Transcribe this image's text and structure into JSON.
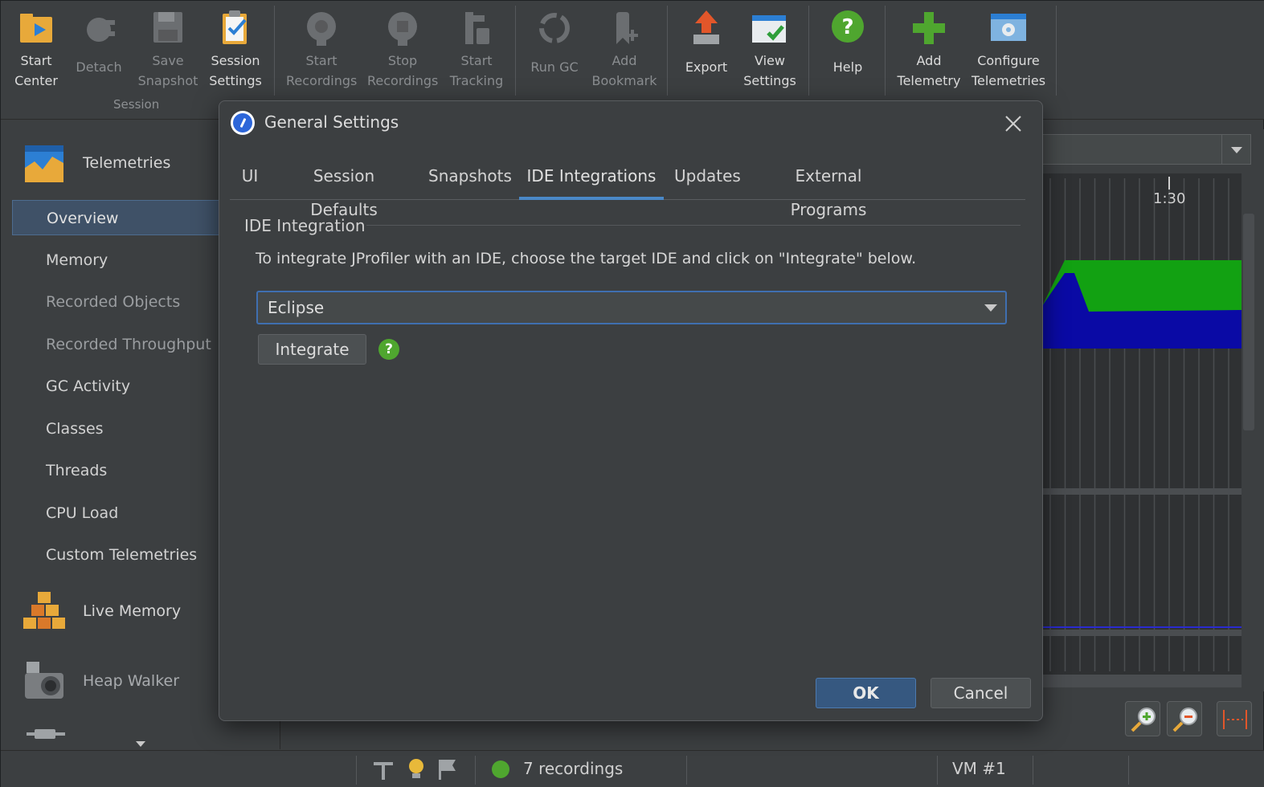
{
  "toolbar": {
    "buttons": [
      {
        "label": "Start\nCenter",
        "icon": "folder-play-icon",
        "enabled": true
      },
      {
        "label": "Detach",
        "icon": "plug-icon",
        "enabled": false
      },
      {
        "label": "Save\nSnapshot",
        "icon": "floppy-disk-icon",
        "enabled": false
      },
      {
        "label": "Session\nSettings",
        "icon": "clipboard-check-icon",
        "enabled": true
      },
      {
        "label": "Start\nRecordings",
        "icon": "record-icon",
        "enabled": false
      },
      {
        "label": "Stop\nRecordings",
        "icon": "stop-record-icon",
        "enabled": false
      },
      {
        "label": "Start\nTracking",
        "icon": "tracking-icon",
        "enabled": false
      },
      {
        "label": "Run GC",
        "icon": "recycle-icon",
        "enabled": false
      },
      {
        "label": "Add\nBookmark",
        "icon": "bookmark-icon",
        "enabled": false
      },
      {
        "label": "Export",
        "icon": "export-arrow-icon",
        "enabled": true
      },
      {
        "label": "View\nSettings",
        "icon": "window-check-icon",
        "enabled": true
      },
      {
        "label": "Help",
        "icon": "help-icon",
        "enabled": true
      },
      {
        "label": "Add\nTelemetry",
        "icon": "plus-icon",
        "enabled": true
      },
      {
        "label": "Configure\nTelemetries",
        "icon": "gear-window-icon",
        "enabled": true
      }
    ],
    "group_session": "Session"
  },
  "sidebar": {
    "telemetries_label": "Telemetries",
    "items": [
      {
        "label": "Overview",
        "selected": true,
        "enabled": true
      },
      {
        "label": "Memory",
        "selected": false,
        "enabled": true
      },
      {
        "label": "Recorded Objects",
        "selected": false,
        "enabled": false
      },
      {
        "label": "Recorded Throughput",
        "selected": false,
        "enabled": false
      },
      {
        "label": "GC Activity",
        "selected": false,
        "enabled": true
      },
      {
        "label": "Classes",
        "selected": false,
        "enabled": true
      },
      {
        "label": "Threads",
        "selected": false,
        "enabled": true
      },
      {
        "label": "CPU Load",
        "selected": false,
        "enabled": true
      },
      {
        "label": "Custom Telemetries",
        "selected": false,
        "enabled": true
      }
    ],
    "live_memory_label": "Live Memory",
    "heap_walker_label": "Heap Walker"
  },
  "chart": {
    "tick_label": "1:30",
    "colors": {
      "green": "#12a112",
      "blue": "#0a0aa5"
    }
  },
  "dialog": {
    "title": "General Settings",
    "tabs": [
      "UI",
      "Session Defaults",
      "Snapshots",
      "IDE Integrations",
      "Updates",
      "External Programs"
    ],
    "selected_tab": "IDE Integrations",
    "group_title": "IDE Integration",
    "description": "To integrate JProfiler with an IDE, choose the target IDE and click on \"Integrate\" below.",
    "ide_select_value": "Eclipse",
    "integrate_label": "Integrate",
    "help_glyph": "?",
    "ok_label": "OK",
    "cancel_label": "Cancel"
  },
  "status": {
    "recordings": "7 recordings",
    "vm": "VM #1"
  }
}
